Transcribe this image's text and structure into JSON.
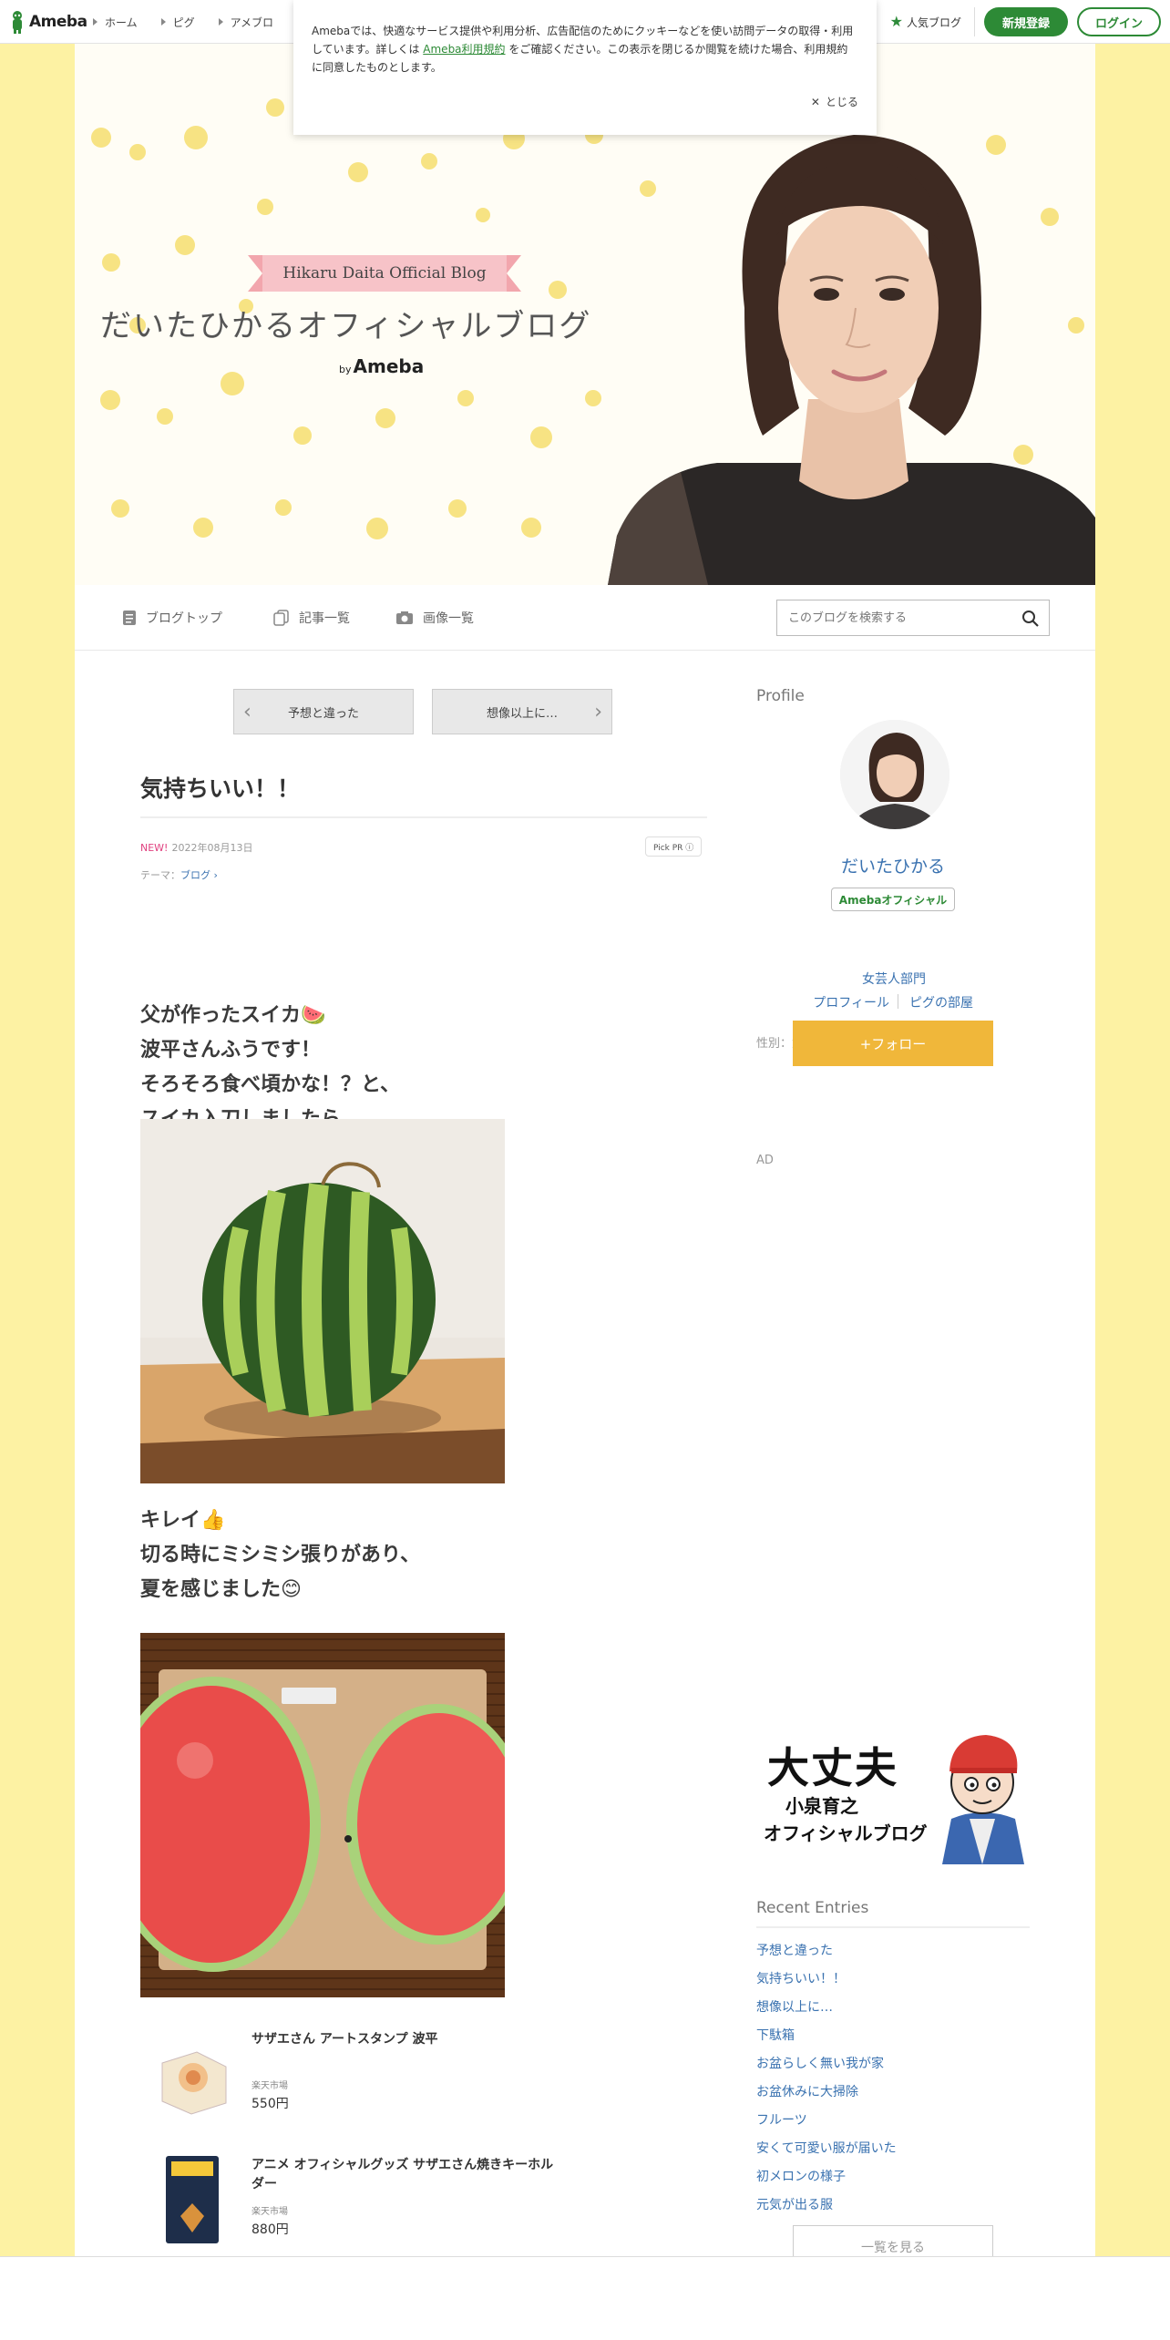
{
  "topbar": {
    "logo_text": "Ameba",
    "nav": [
      "ホーム",
      "ピグ",
      "アメブロ"
    ],
    "popular_label": "人気ブログ",
    "signup_label": "新規登録",
    "login_label": "ログイン"
  },
  "cookie": {
    "text_before": "Amebaでは、快適なサービス提供や利用分析、広告配信のためにクッキーなどを使い訪問データの取得・利用しています。詳しくは",
    "link": "Ameba利用規約",
    "text_after": "をご確認ください。この表示を閉じるか閲覧を続けた場合、利用規約に同意したものとします。",
    "close_label": "とじる"
  },
  "header": {
    "ribbon": "Hikaru Daita Official Blog",
    "title": "だいたひかるオフィシャルブログ",
    "by": "by",
    "brand": "Ameba"
  },
  "blognav": {
    "top": "ブログトップ",
    "entries": "記事一覧",
    "images": "画像一覧",
    "search_placeholder": "このブログを検索する"
  },
  "article": {
    "prev": "予想と違った",
    "next": "想像以上に…",
    "title": "気持ちいい！！",
    "new_badge": "NEW!",
    "date": "2022年08月13日",
    "pickpr": "Pick PR ⓘ",
    "theme_label": "テーマ：",
    "theme": "ブログ",
    "para1": [
      "父が作ったスイカ🍉",
      "波平さんふうです！",
      "そろそろ食べ頃かな！？と、",
      "スイカ入刀しましたら…"
    ],
    "para2": [
      "キレイ👍",
      "切る時にミシミシ張りがあり、",
      "夏を感じました😊"
    ],
    "products": [
      {
        "name": "サザエさん アートスタンプ 波平",
        "shop": "楽天市場",
        "price": "550円"
      },
      {
        "name": "アニメ オフィシャルグッズ サザエさん焼きキーホルダー",
        "shop": "楽天市場",
        "price": "880円"
      }
    ]
  },
  "sidebar": {
    "profile_heading": "Profile",
    "name": "だいたひかる",
    "official": "Amebaオフィシャル",
    "category": "女芸人部門",
    "profile_link": "プロフィール",
    "pig_link": "ピグの部屋",
    "gender": "性別：女性",
    "follow": "+フォロー",
    "ad": "AD",
    "banner_title": "大丈夫",
    "banner_name": "小泉育之",
    "banner_sub": "オフィシャルブログ",
    "recent_heading": "Recent Entries",
    "recent": [
      "予想と違った",
      "気持ちいい！！",
      "想像以上に…",
      "下駄箱",
      "お盆らしく無い我が家",
      "お盆休みに大掃除",
      "フルーツ",
      "安くて可愛い服が届いた",
      "初メロンの様子",
      "元気が出る服"
    ],
    "more": "一覧を見る"
  },
  "colors": {
    "background": "#fdf2a3",
    "ameba_green": "#2d8a36",
    "link_blue": "#3a72b0",
    "follow_orange": "#f0b73a",
    "new_pink": "#e0407f"
  }
}
